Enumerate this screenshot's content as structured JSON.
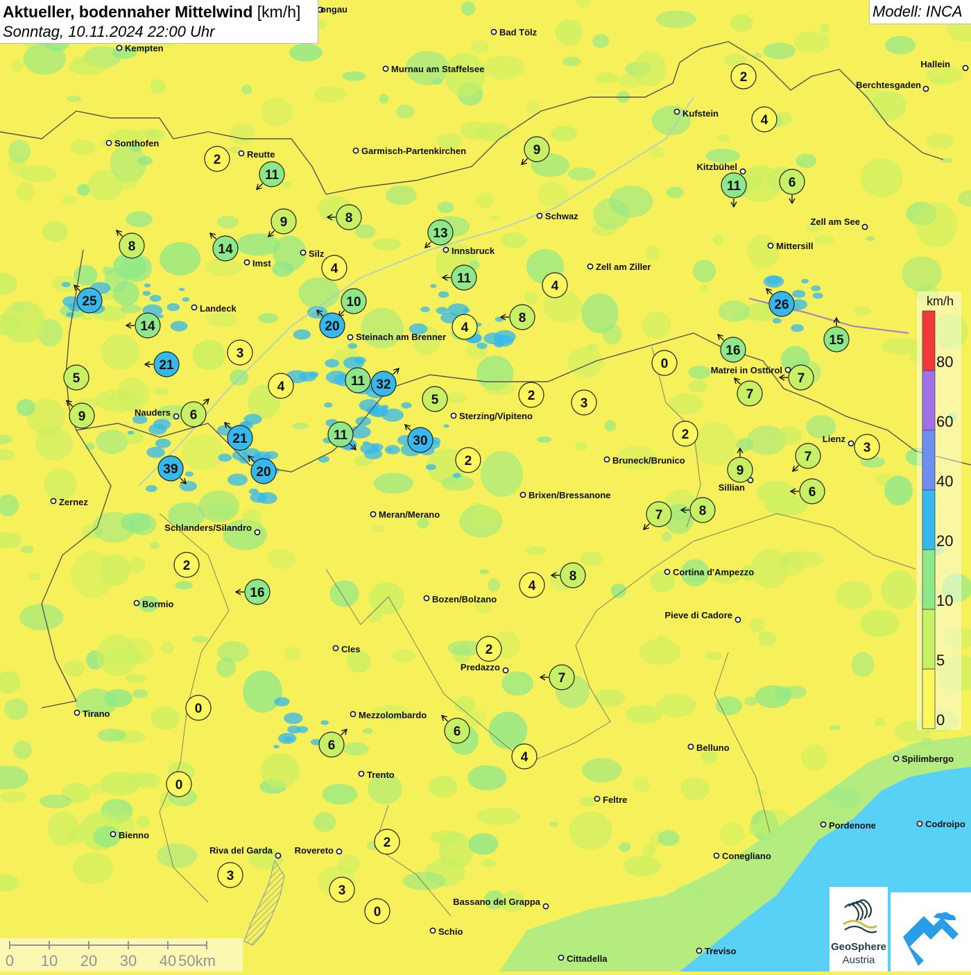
{
  "header": {
    "title": "Aktueller, bodennaher Mittelwind",
    "unit": "[km/h]",
    "datetime": "Sonntag, 10.11.2024 22:00 Uhr"
  },
  "model_label": "Modell: INCA",
  "colors": {
    "base": "#f6f05a",
    "class_0": "#fbf75c",
    "class_5": "#c8f064",
    "class_10": "#8ee88a",
    "class_20": "#36b8ec",
    "class_40": "#6e8ef0",
    "class_60": "#a070e8",
    "class_80": "#f03a3a",
    "sea": "#59d0f6",
    "border": "#555555"
  },
  "legend": {
    "unit": "km/h",
    "ticks": [
      "0",
      "5",
      "10",
      "20",
      "40",
      "60",
      "80"
    ]
  },
  "scale_bar": {
    "ticks": [
      "0",
      "10",
      "20",
      "30",
      "40",
      "50km"
    ]
  },
  "logo": {
    "name": "GeoSphere",
    "sub": "Austria"
  },
  "cities": [
    {
      "name": "Kempten"
    },
    {
      "name": "Bad Tölz"
    },
    {
      "name": "Murnau am Staffelsee"
    },
    {
      "name": "Hallein"
    },
    {
      "name": "Berchtesgaden"
    },
    {
      "name": "Kufstein"
    },
    {
      "name": "Sonthofen"
    },
    {
      "name": "Reutte"
    },
    {
      "name": "Garmisch-Partenkirchen"
    },
    {
      "name": "Kitzbühel"
    },
    {
      "name": "Schwaz"
    },
    {
      "name": "Zell am See"
    },
    {
      "name": "Innsbruck"
    },
    {
      "name": "Mittersill"
    },
    {
      "name": "Silz"
    },
    {
      "name": "Imst"
    },
    {
      "name": "Zell am Ziller"
    },
    {
      "name": "Landeck"
    },
    {
      "name": "Steinach am Brenner"
    },
    {
      "name": "Matrei in Osttirol"
    },
    {
      "name": "Nauders"
    },
    {
      "name": "Sterzing/Vipiteno"
    },
    {
      "name": "Lienz"
    },
    {
      "name": "Bruneck/Brunico"
    },
    {
      "name": "Sillian"
    },
    {
      "name": "Zernez"
    },
    {
      "name": "Brixen/Bressanone"
    },
    {
      "name": "Meran/Merano"
    },
    {
      "name": "Schlanders/Silandro"
    },
    {
      "name": "Cortina d'Ampezzo"
    },
    {
      "name": "Bormio"
    },
    {
      "name": "Bozen/Bolzano"
    },
    {
      "name": "Pieve di Cadore"
    },
    {
      "name": "Cles"
    },
    {
      "name": "Predazzo"
    },
    {
      "name": "Tirano"
    },
    {
      "name": "Mezzolombardo"
    },
    {
      "name": "Belluno"
    },
    {
      "name": "Spilimbergo"
    },
    {
      "name": "Trento"
    },
    {
      "name": "Feltre"
    },
    {
      "name": "Bienno"
    },
    {
      "name": "Pordenone"
    },
    {
      "name": "Codroipo"
    },
    {
      "name": "Riva del Garda"
    },
    {
      "name": "Rovereto"
    },
    {
      "name": "Conegliano"
    },
    {
      "name": "Bassano del Grappa"
    },
    {
      "name": "Schio"
    },
    {
      "name": "Treviso"
    },
    {
      "name": "Cittadella"
    },
    {
      "name": "ongau"
    }
  ],
  "stations": [
    {
      "v": "2",
      "dir": null
    },
    {
      "v": "4",
      "dir": null
    },
    {
      "v": "9",
      "dir": "sw"
    },
    {
      "v": "2",
      "dir": null
    },
    {
      "v": "11",
      "dir": "sw"
    },
    {
      "v": "11",
      "dir": "s"
    },
    {
      "v": "6",
      "dir": "s"
    },
    {
      "v": "9",
      "dir": "sw"
    },
    {
      "v": "8",
      "dir": "w"
    },
    {
      "v": "13",
      "dir": "sw"
    },
    {
      "v": "8",
      "dir": "nw"
    },
    {
      "v": "14",
      "dir": "nw"
    },
    {
      "v": "4",
      "dir": null
    },
    {
      "v": "11",
      "dir": "w"
    },
    {
      "v": "4",
      "dir": null
    },
    {
      "v": "25",
      "dir": "nw"
    },
    {
      "v": "10",
      "dir": "sw"
    },
    {
      "v": "20",
      "dir": "nw"
    },
    {
      "v": "8",
      "dir": "w"
    },
    {
      "v": "4",
      "dir": null
    },
    {
      "v": "26",
      "dir": "nw"
    },
    {
      "v": "14",
      "dir": "w"
    },
    {
      "v": "15",
      "dir": "n"
    },
    {
      "v": "16",
      "dir": "nw"
    },
    {
      "v": "3",
      "dir": null
    },
    {
      "v": "0",
      "dir": null
    },
    {
      "v": "21",
      "dir": "w"
    },
    {
      "v": "11",
      "dir": null
    },
    {
      "v": "32",
      "dir": "ne"
    },
    {
      "v": "7",
      "dir": "w"
    },
    {
      "v": "5",
      "dir": null
    },
    {
      "v": "4",
      "dir": null
    },
    {
      "v": "5",
      "dir": null
    },
    {
      "v": "2",
      "dir": null
    },
    {
      "v": "3",
      "dir": null
    },
    {
      "v": "7",
      "dir": "nw"
    },
    {
      "v": "9",
      "dir": "nw"
    },
    {
      "v": "6",
      "dir": "ne"
    },
    {
      "v": "21",
      "dir": "nw"
    },
    {
      "v": "2",
      "dir": null
    },
    {
      "v": "11",
      "dir": "se"
    },
    {
      "v": "30",
      "dir": "nw"
    },
    {
      "v": "3",
      "dir": null
    },
    {
      "v": "2",
      "dir": null
    },
    {
      "v": "7",
      "dir": "sw"
    },
    {
      "v": "9",
      "dir": "n"
    },
    {
      "v": "39",
      "dir": "se"
    },
    {
      "v": "20",
      "dir": "nw"
    },
    {
      "v": "6",
      "dir": "w"
    },
    {
      "v": "8",
      "dir": "w"
    },
    {
      "v": "7",
      "dir": "sw"
    },
    {
      "v": "2",
      "dir": null
    },
    {
      "v": "16",
      "dir": "w"
    },
    {
      "v": "4",
      "dir": null
    },
    {
      "v": "8",
      "dir": "w"
    },
    {
      "v": "2",
      "dir": null
    },
    {
      "v": "7",
      "dir": "w"
    },
    {
      "v": "0",
      "dir": null
    },
    {
      "v": "6",
      "dir": "nw"
    },
    {
      "v": "6",
      "dir": "ne"
    },
    {
      "v": "4",
      "dir": null
    },
    {
      "v": "0",
      "dir": null
    },
    {
      "v": "2",
      "dir": null
    },
    {
      "v": "3",
      "dir": null
    },
    {
      "v": "3",
      "dir": null
    },
    {
      "v": "0",
      "dir": null
    }
  ]
}
